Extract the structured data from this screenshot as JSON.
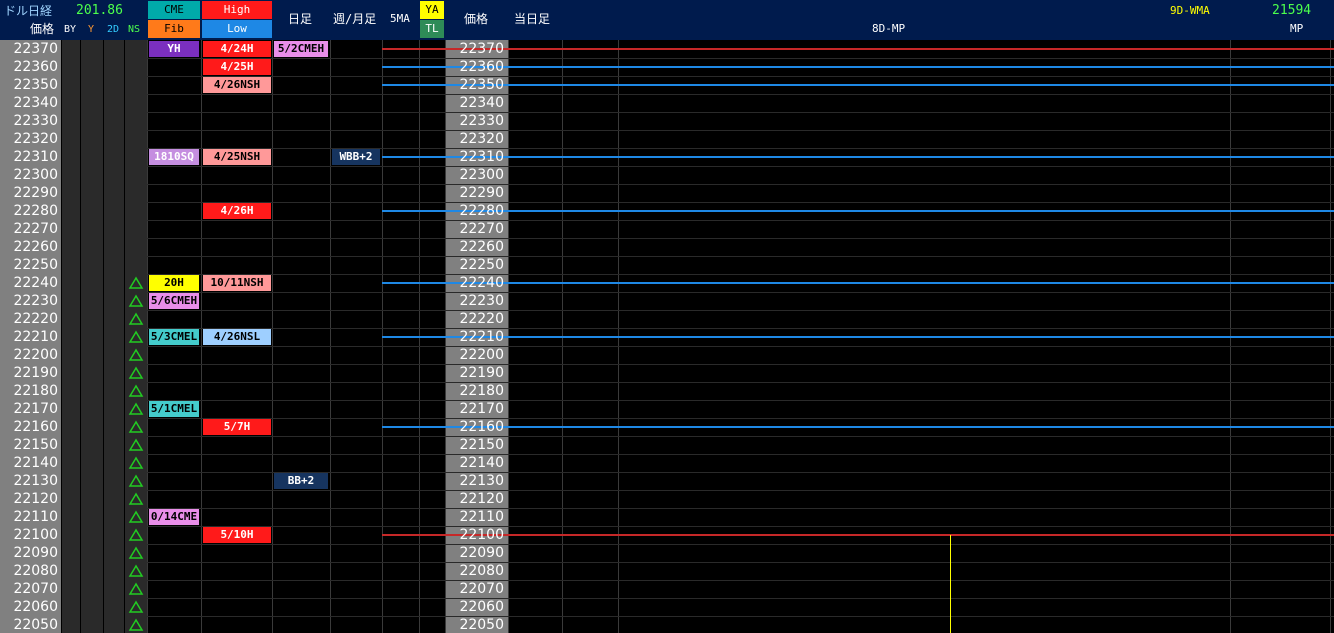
{
  "header": {
    "title": "ドル日経",
    "title_sub": "価格",
    "usd_value": "201.86",
    "sub_cols": [
      "BY",
      "Y",
      "2D",
      "NS"
    ],
    "cme": "CME",
    "fib": "Fib",
    "high": "High",
    "low": "Low",
    "daily": "日足",
    "weekly_monthly": "週/月足",
    "five_ma": "5MA",
    "ya": "YA",
    "tl": "TL",
    "price2": "価格",
    "today": "当日足",
    "mp_label": "8D-MP",
    "wma_label": "9D-WMA",
    "wma_value": "21594",
    "mp": "MP"
  },
  "prices": [
    22370,
    22360,
    22350,
    22340,
    22330,
    22320,
    22310,
    22300,
    22290,
    22280,
    22270,
    22260,
    22250,
    22240,
    22230,
    22220,
    22210,
    22200,
    22190,
    22180,
    22170,
    22160,
    22150,
    22140,
    22130,
    22120,
    22110,
    22100,
    22090,
    22080,
    22070,
    22060,
    22050
  ],
  "ns_triangles": [
    22240,
    22230,
    22220,
    22210,
    22200,
    22190,
    22180,
    22170,
    22160,
    22150,
    22140,
    22130,
    22120,
    22110,
    22100,
    22090,
    22080,
    22070,
    22060,
    22050
  ],
  "labels": [
    {
      "col": "cme",
      "price": 22370,
      "text": "YH",
      "bg": "#7b2fbf",
      "fg": "#ffffff"
    },
    {
      "col": "high",
      "price": 22370,
      "text": "4/24H",
      "bg": "#ff1a1a",
      "fg": "#ffffff"
    },
    {
      "col": "daily",
      "price": 22370,
      "text": "5/2CMEH",
      "bg": "#e98ee9",
      "fg": "#000000"
    },
    {
      "col": "high",
      "price": 22360,
      "text": "4/25H",
      "bg": "#ff1a1a",
      "fg": "#ffffff"
    },
    {
      "col": "high",
      "price": 22350,
      "text": "4/26NSH",
      "bg": "#ff9999",
      "fg": "#000000"
    },
    {
      "col": "cme",
      "price": 22310,
      "text": "1810SQ",
      "bg": "#c58ee0",
      "fg": "#ffffff"
    },
    {
      "col": "high",
      "price": 22310,
      "text": "4/25NSH",
      "bg": "#ff9999",
      "fg": "#000000"
    },
    {
      "col": "weekly",
      "price": 22310,
      "text": "WBB+2",
      "bg": "#16345f",
      "fg": "#ffffff"
    },
    {
      "col": "high",
      "price": 22280,
      "text": "4/26H",
      "bg": "#ff1a1a",
      "fg": "#ffffff"
    },
    {
      "col": "cme",
      "price": 22240,
      "text": "20H",
      "bg": "#ffff00",
      "fg": "#000000"
    },
    {
      "col": "high",
      "price": 22240,
      "text": "10/11NSH",
      "bg": "#ff9999",
      "fg": "#000000"
    },
    {
      "col": "cme",
      "price": 22230,
      "text": "5/6CMEH",
      "bg": "#e98ee9",
      "fg": "#000000"
    },
    {
      "col": "cme",
      "price": 22210,
      "text": "5/3CMEL",
      "bg": "#44cccc",
      "fg": "#000000"
    },
    {
      "col": "high",
      "price": 22210,
      "text": "4/26NSL",
      "bg": "#9ecfff",
      "fg": "#000000"
    },
    {
      "col": "cme",
      "price": 22170,
      "text": "5/1CMEL",
      "bg": "#44cccc",
      "fg": "#000000"
    },
    {
      "col": "high",
      "price": 22160,
      "text": "5/7H",
      "bg": "#ff1a1a",
      "fg": "#ffffff"
    },
    {
      "col": "daily",
      "price": 22130,
      "text": "BB+2",
      "bg": "#16345f",
      "fg": "#ffffff"
    },
    {
      "col": "cme",
      "price": 22110,
      "text": "0/14CME",
      "bg": "#e98ee9",
      "fg": "#000000"
    },
    {
      "col": "high",
      "price": 22100,
      "text": "5/10H",
      "bg": "#ff1a1a",
      "fg": "#ffffff"
    }
  ],
  "hlines": [
    {
      "price": 22370,
      "color": "#c62828"
    },
    {
      "price": 22360,
      "color": "#1e88e5"
    },
    {
      "price": 22350,
      "color": "#1e88e5"
    },
    {
      "price": 22310,
      "color": "#1e88e5"
    },
    {
      "price": 22280,
      "color": "#1e88e5"
    },
    {
      "price": 22240,
      "color": "#1e88e5"
    },
    {
      "price": 22210,
      "color": "#1e88e5"
    },
    {
      "price": 22160,
      "color": "#1e88e5"
    },
    {
      "price": 22100,
      "color": "#c62828"
    }
  ],
  "mp_marker_price": 22095,
  "colors": {
    "header": "#001b4d",
    "grid": "#3a3a3a",
    "price_bg": "#808080",
    "tri": "#22cc22",
    "yellow": "#ffff00"
  }
}
